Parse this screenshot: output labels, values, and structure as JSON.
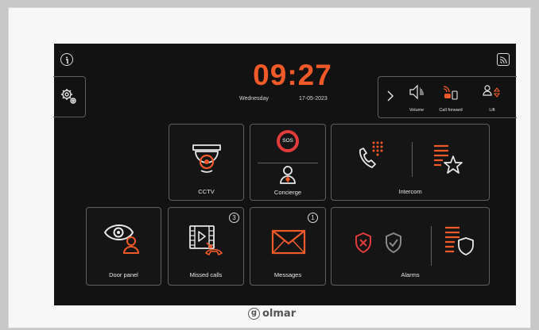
{
  "clock": {
    "time": "09:27",
    "day": "Wednesday",
    "date": "17-05-2023"
  },
  "status_bar": {
    "items": [
      {
        "label": "Volume"
      },
      {
        "label": "Call forward"
      },
      {
        "label": "Lift"
      }
    ]
  },
  "tiles": {
    "cctv": "CCTV",
    "sos": "SOS",
    "concierge": "Concierge",
    "intercom": "Intercom",
    "door_panel": "Door panel",
    "missed_calls": "Missed calls",
    "missed_calls_count": "3",
    "messages": "Messages",
    "messages_count": "1",
    "alarms": "Alarms"
  },
  "brand": {
    "name": "olmar",
    "mark": "g"
  },
  "colors": {
    "accent": "#f05a28",
    "alarm_red": "#e23b3b",
    "screen_bg": "#121212"
  },
  "icons": [
    "info-icon",
    "settings-gear-icon",
    "wifi-signal-icon",
    "chevron-right-icon",
    "volume-icon",
    "call-forward-icon",
    "lift-icon",
    "dome-camera-icon",
    "person-icon",
    "phone-keypad-icon",
    "list-star-icon",
    "eye-person-icon",
    "film-missed-call-icon",
    "envelope-icon",
    "shield-x-icon",
    "shield-check-icon",
    "list-shield-icon"
  ]
}
